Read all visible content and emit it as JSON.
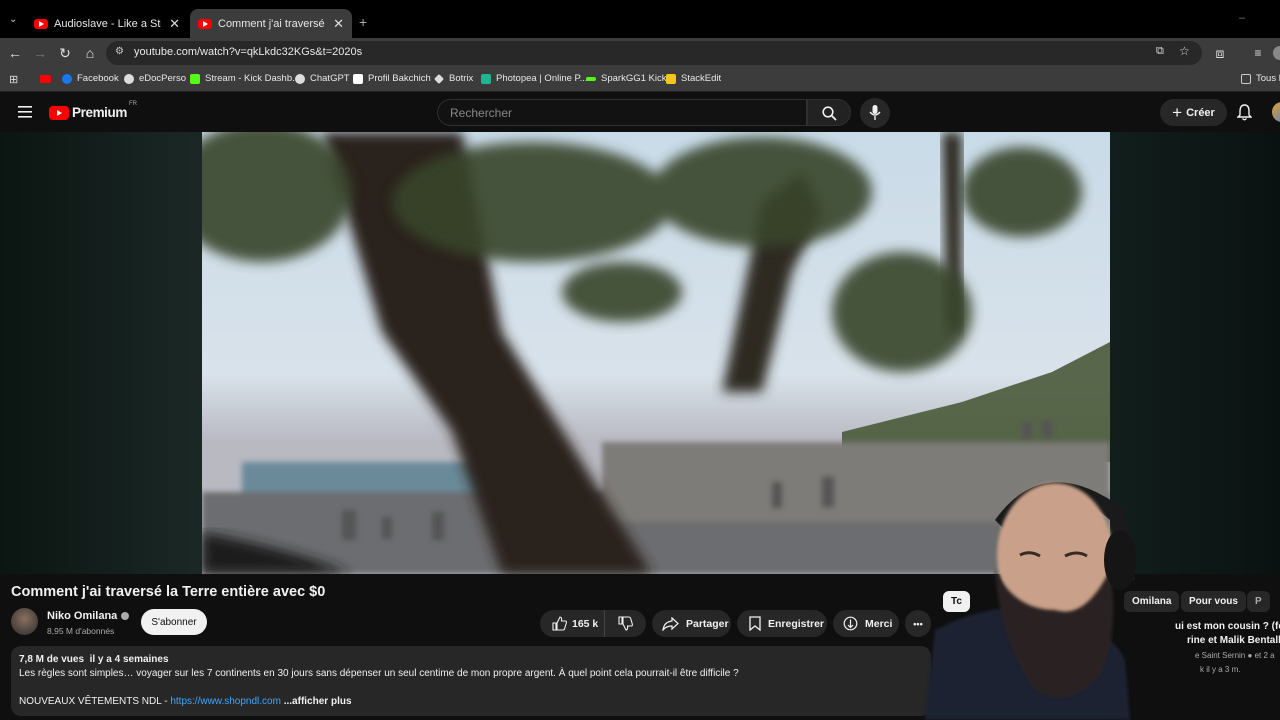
{
  "browser": {
    "tabs": [
      {
        "title": "Audioslave - Like a Stone (Offic"
      },
      {
        "title": "Comment j'ai traversé la Terre e"
      }
    ],
    "url": "youtube.com/watch?v=qkLkdc32KGs&t=2020s",
    "bookmarks": [
      {
        "label": "Facebook",
        "color": "#1877f2"
      },
      {
        "label": "eDocPerso",
        "color": "#dddddd"
      },
      {
        "label": "Stream - Kick Dashb...",
        "color": "#53fc18"
      },
      {
        "label": "ChatGPT",
        "color": "#dddddd"
      },
      {
        "label": "Profil Bakchich",
        "color": "#ffffff"
      },
      {
        "label": "Botrix",
        "color": "#dddddd"
      },
      {
        "label": "Photopea | Online P...",
        "color": "#1fb58f"
      },
      {
        "label": "SparkGG1 Kick",
        "color": "#53fc18"
      },
      {
        "label": "StackEdit",
        "color": "#f5c518"
      }
    ],
    "all_bookmarks": "Tous l"
  },
  "youtube": {
    "logo_text": "Premium",
    "region": "FR",
    "search_placeholder": "Rechercher",
    "create_label": "Créer",
    "brand_color": "#ff0000"
  },
  "video": {
    "title": "Comment j'ai traversé la Terre entière avec $0",
    "channel": "Niko Omilana",
    "subscribers": "8,95 M d'abonnés",
    "subscribe_label": "S'abonner",
    "likes": "165 k",
    "share_label": "Partager",
    "save_label": "Enregistrer",
    "thanks_label": "Merci",
    "more_label": "•••"
  },
  "description": {
    "views": "7,8 M de vues",
    "age": "il y a 4 semaines",
    "line1": "Les règles sont simples… voyager sur les 7 continents en 30 jours sans dépenser un seul centime de mon propre argent. À quel point cela pourrait-il être difficile ?",
    "line2_prefix": "NOUVEAUX VÊTEMENTS NDL - ",
    "link": "https://www.shopndl.com",
    "more": "...afficher plus"
  },
  "sidebar": {
    "chips": [
      "Tc",
      "Omilana",
      "Pour vous",
      "P"
    ],
    "rec_title_1": "ui est mon cousin ? (fea",
    "rec_title_2": "rine et Malik Bentalha",
    "rec_channel": "e Saint Sernin",
    "rec_views": "et 2 a",
    "rec_age": "k  il y a 3 m."
  }
}
